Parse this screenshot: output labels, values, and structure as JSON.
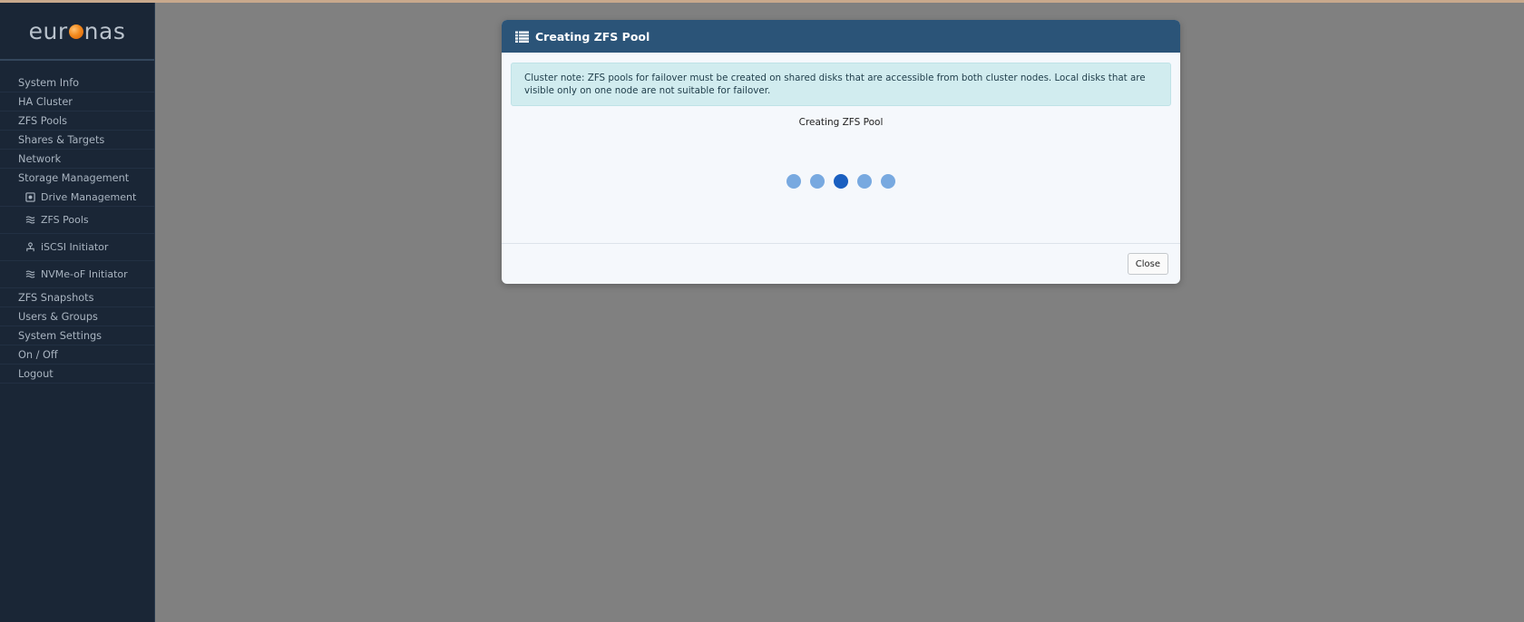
{
  "logo": {
    "prefix": "eur",
    "suffix": "nas"
  },
  "sidebar": {
    "items_top": [
      {
        "label": "System Info"
      },
      {
        "label": "HA Cluster"
      },
      {
        "label": "ZFS Pools"
      },
      {
        "label": "Shares & Targets"
      },
      {
        "label": "Network"
      },
      {
        "label": "Storage Management"
      }
    ],
    "sub_items": [
      {
        "label": "Drive Management",
        "icon": "drive-icon"
      },
      {
        "label": "ZFS Pools",
        "icon": "layers-icon"
      },
      {
        "label": "iSCSI Initiator",
        "icon": "initiator-icon"
      },
      {
        "label": "NVMe-oF Initiator",
        "icon": "layers-icon"
      }
    ],
    "items_bottom": [
      {
        "label": "ZFS Snapshots"
      },
      {
        "label": "Users & Groups"
      },
      {
        "label": "System Settings"
      },
      {
        "label": "On / Off"
      },
      {
        "label": "Logout"
      }
    ]
  },
  "modal": {
    "title": "Creating ZFS Pool",
    "header_icon": "list-icon",
    "note": "Cluster note: ZFS pools for failover must be created on shared disks that are accessible from both cluster nodes. Local disks that are visible only on one node are not suitable for failover.",
    "status": "Creating ZFS Pool",
    "close_label": "Close",
    "loader": {
      "dot_count": 5,
      "active_index": 2
    },
    "colors": {
      "header": "#2b5478",
      "dot": "#78a9e0",
      "dot_active": "#1a5fc0",
      "alert_bg": "#d1ecef"
    }
  }
}
